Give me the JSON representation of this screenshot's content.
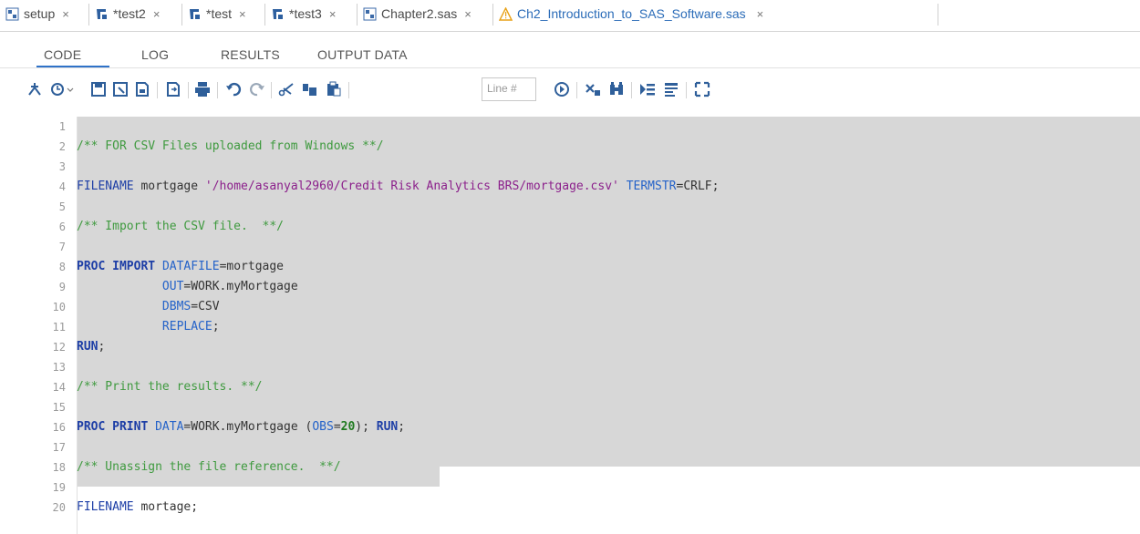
{
  "tabs": [
    {
      "label": "setup",
      "icon": "sas-program-icon",
      "active": false
    },
    {
      "label": "*test2",
      "icon": "process-flow-icon",
      "active": false
    },
    {
      "label": "*test",
      "icon": "process-flow-icon",
      "active": false
    },
    {
      "label": "*test3",
      "icon": "process-flow-icon",
      "active": false
    },
    {
      "label": "Chapter2.sas",
      "icon": "sas-program-icon",
      "active": false
    },
    {
      "label": "Ch2_Introduction_to_SAS_Software.sas",
      "icon": "warning-icon",
      "active": true
    }
  ],
  "tab_close_glyph": "×",
  "subtabs": [
    "CODE",
    "LOG",
    "RESULTS",
    "OUTPUT DATA"
  ],
  "active_subtab": "CODE",
  "toolbar": {
    "line_placeholder": "Line #",
    "icons": [
      "run-icon",
      "history-icon",
      "save-icon",
      "save-as-icon",
      "save-file-icon",
      "export-icon",
      "print-icon",
      "undo-icon",
      "redo-icon",
      "cut-icon",
      "copy-icon",
      "paste-icon",
      "go-to-line-icon",
      "clear-icon",
      "find-icon",
      "format-code-icon",
      "snippet-icon",
      "maximize-icon"
    ]
  },
  "colors": {
    "selection": "#d7d7d7",
    "comment": "#3f9a3f",
    "keyword": "#1d3ea6",
    "string": "#8b1f8b",
    "active_tab": "#2b6cb8"
  },
  "code": {
    "lines": [
      {
        "n": "1",
        "text": ""
      },
      {
        "n": "2",
        "text": "/** FOR CSV Files uploaded from Windows **/"
      },
      {
        "n": "3",
        "text": ""
      },
      {
        "n": "4",
        "text": "FILENAME mortgage '/home/asanyal2960/Credit Risk Analytics BRS/mortgage.csv' TERMSTR=CRLF;"
      },
      {
        "n": "5",
        "text": ""
      },
      {
        "n": "6",
        "text": "/** Import the CSV file.  **/"
      },
      {
        "n": "7",
        "text": ""
      },
      {
        "n": "8",
        "text": "PROC IMPORT DATAFILE=mortgage"
      },
      {
        "n": "9",
        "text": "            OUT=WORK.myMortgage"
      },
      {
        "n": "10",
        "text": "            DBMS=CSV"
      },
      {
        "n": "11",
        "text": "            REPLACE;"
      },
      {
        "n": "12",
        "text": "RUN;"
      },
      {
        "n": "13",
        "text": ""
      },
      {
        "n": "14",
        "text": "/** Print the results. **/"
      },
      {
        "n": "15",
        "text": ""
      },
      {
        "n": "16",
        "text": "PROC PRINT DATA=WORK.myMortgage (OBS=20); RUN;"
      },
      {
        "n": "17",
        "text": ""
      },
      {
        "n": "18",
        "text": "/** Unassign the file reference.  **/"
      },
      {
        "n": "19",
        "text": ""
      },
      {
        "n": "20",
        "text": "FILENAME mortage;"
      }
    ]
  }
}
